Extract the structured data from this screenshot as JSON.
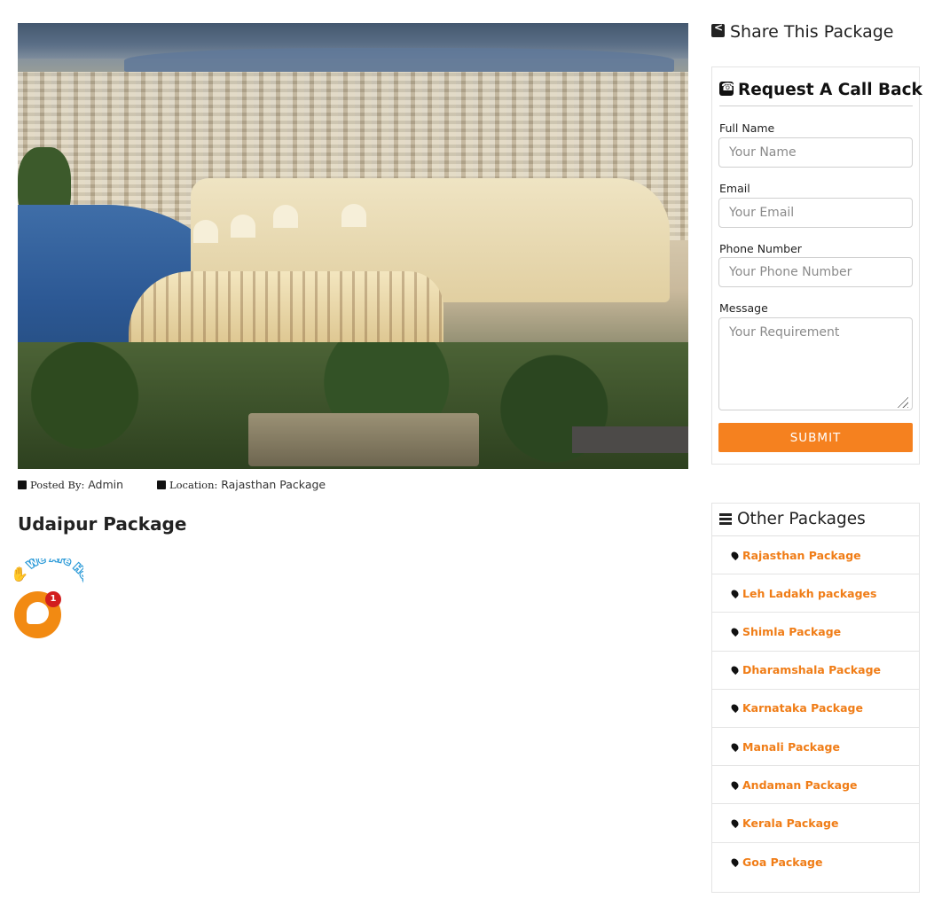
{
  "hero": {
    "image_name": "udaipur-city-palace-photo"
  },
  "meta": {
    "posted_by_label": "Posted By:",
    "posted_by_value": "Admin",
    "location_label": "Location:",
    "location_value": "Rajasthan Package"
  },
  "page_title": "Udaipur Package",
  "chat": {
    "arc_text": "We Are Here!",
    "badge_count": "1",
    "accent": "#f28a12"
  },
  "share": {
    "title": "Share This Package"
  },
  "callback": {
    "title": "Request A Call Back",
    "fields": {
      "name_label": "Full Name",
      "name_placeholder": "Your Name",
      "email_label": "Email",
      "email_placeholder": "Your Email",
      "phone_label": "Phone Number",
      "phone_placeholder": "Your Phone Number",
      "message_label": "Message",
      "message_placeholder": "Your Requirement"
    },
    "submit_label": "SUBMIT",
    "submit_color": "#f5811f"
  },
  "other_packages": {
    "title": "Other Packages",
    "link_color": "#f07d17",
    "items": [
      "Rajasthan Package",
      "Leh Ladakh packages",
      "Shimla Package",
      "Dharamshala Package",
      "Karnataka Package",
      "Manali Package",
      "Andaman Package",
      "Kerala Package",
      "Goa Package"
    ]
  }
}
